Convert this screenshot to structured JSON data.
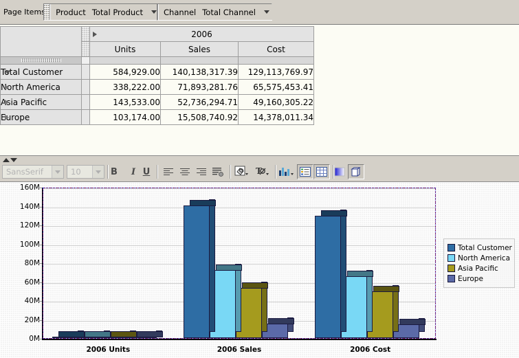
{
  "page_items": {
    "label": "Page Items",
    "chips": [
      {
        "dimension": "Product",
        "value": "Total Product",
        "arrow": "chevron-down-icon"
      },
      {
        "dimension": "Channel",
        "value": "Total Channel",
        "arrow": "chevron-down-icon"
      }
    ]
  },
  "crosstab": {
    "year_header": "2006",
    "measure_headers": [
      "Units",
      "Sales",
      "Cost"
    ],
    "rows": [
      {
        "label": "Total Customer",
        "expanded": true,
        "indent": 0,
        "values": [
          "584,929.00",
          "140,138,317.39",
          "129,113,769.97"
        ]
      },
      {
        "label": "North America",
        "expanded": false,
        "indent": 1,
        "values": [
          "338,222.00",
          "71,893,281.76",
          "65,575,453.41"
        ]
      },
      {
        "label": "Asia Pacific",
        "expanded": false,
        "indent": 1,
        "values": [
          "143,533.00",
          "52,736,294.71",
          "49,160,305.22"
        ]
      },
      {
        "label": "Europe",
        "expanded": false,
        "indent": 1,
        "values": [
          "103,174.00",
          "15,508,740.92",
          "14,378,011.34"
        ]
      }
    ]
  },
  "format_toolbar": {
    "font_name": "SansSerif",
    "font_size": "10",
    "buttons": [
      {
        "name": "bold-button",
        "label": "B"
      },
      {
        "name": "italic-button",
        "label": "I"
      },
      {
        "name": "underline-button",
        "label": "U"
      },
      {
        "name": "align-left-button",
        "label": ""
      },
      {
        "name": "align-center-button",
        "label": ""
      },
      {
        "name": "align-right-button",
        "label": ""
      },
      {
        "name": "text-indent-button",
        "label": ""
      },
      {
        "name": "fill-color-button",
        "label": ""
      },
      {
        "name": "font-color-button",
        "label": ""
      },
      {
        "name": "chart-type-button",
        "label": ""
      },
      {
        "name": "show-table-button",
        "label": ""
      },
      {
        "name": "show-grid-button",
        "label": ""
      },
      {
        "name": "gradient-button",
        "label": ""
      },
      {
        "name": "three-d-button",
        "label": ""
      }
    ]
  },
  "chart_data": {
    "type": "bar",
    "title": "",
    "xlabel": "",
    "ylabel": "",
    "categories": [
      "2006 Units",
      "2006 Sales",
      "2006 Cost"
    ],
    "series": [
      {
        "name": "Total Customer",
        "color": "#2e6da4",
        "values": [
          584929,
          140138317.39,
          129113769.97
        ]
      },
      {
        "name": "North America",
        "color": "#79d8f5",
        "values": [
          338222,
          71893281.76,
          65575453.41
        ]
      },
      {
        "name": "Asia Pacific",
        "color": "#a59b1e",
        "values": [
          143533,
          52736294.71,
          49160305.22
        ]
      },
      {
        "name": "Europe",
        "color": "#5b6aa8",
        "values": [
          103174,
          15508740.92,
          14378011.34
        ]
      }
    ],
    "ylim": [
      0,
      160000000
    ],
    "ytick_labels": [
      "160M",
      "140M",
      "120M",
      "100M",
      "80M",
      "60M",
      "40M",
      "20M",
      "0M"
    ],
    "ytick_values": [
      160000000,
      140000000,
      120000000,
      100000000,
      80000000,
      60000000,
      40000000,
      20000000,
      0
    ],
    "grid": true,
    "legend_position": "right",
    "legend_entries": [
      "Total Customer",
      "North America",
      "Asia Pacific",
      "Europe"
    ],
    "plot_border_color": "#cc2222"
  }
}
